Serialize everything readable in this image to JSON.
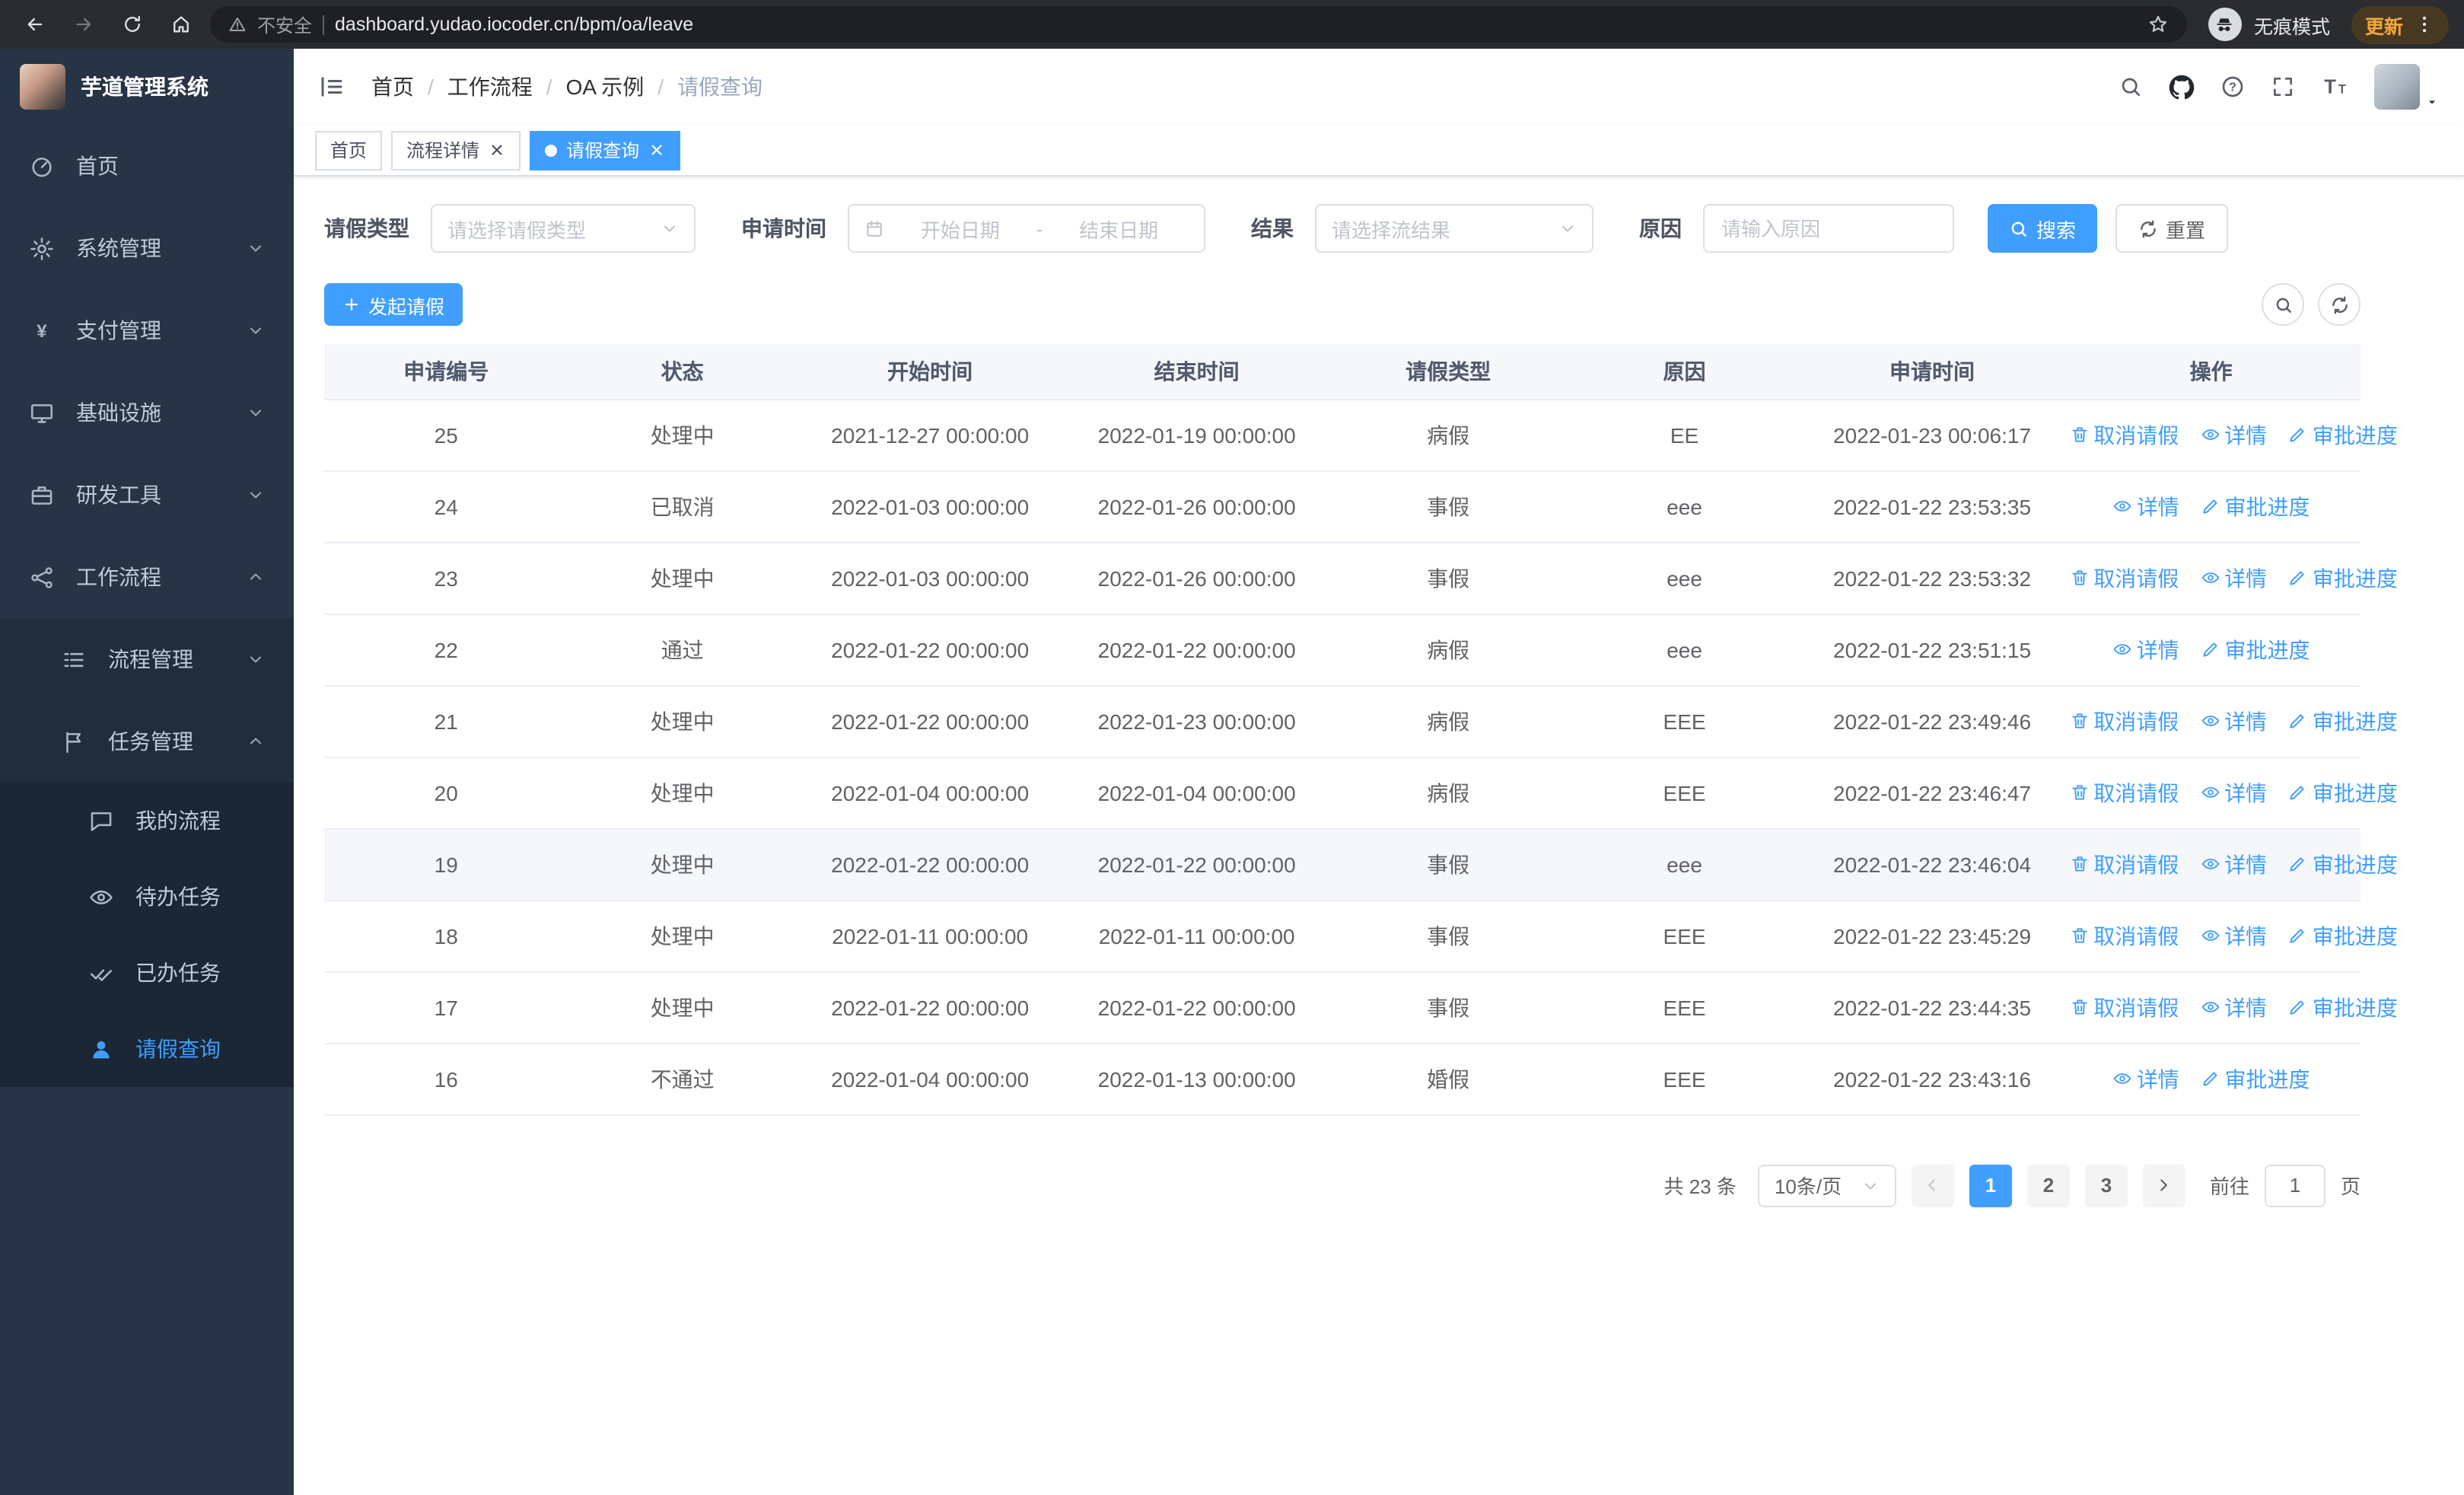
{
  "browser": {
    "security_label": "不安全",
    "url": "dashboard.yudao.iocoder.cn/bpm/oa/leave",
    "incognito_label": "无痕模式",
    "update_label": "更新"
  },
  "sidebar": {
    "logo_title": "芋道管理系统",
    "items": [
      {
        "label": "首页"
      },
      {
        "label": "系统管理"
      },
      {
        "label": "支付管理"
      },
      {
        "label": "基础设施"
      },
      {
        "label": "研发工具"
      },
      {
        "label": "工作流程"
      }
    ],
    "workflow_children": [
      {
        "label": "流程管理"
      },
      {
        "label": "任务管理"
      }
    ],
    "task_children": [
      {
        "label": "我的流程"
      },
      {
        "label": "待办任务"
      },
      {
        "label": "已办任务"
      },
      {
        "label": "请假查询"
      }
    ]
  },
  "breadcrumb": {
    "separator": "/",
    "items": [
      "首页",
      "工作流程",
      "OA 示例",
      "请假查询"
    ]
  },
  "tabs": [
    {
      "label": "首页"
    },
    {
      "label": "流程详情"
    },
    {
      "label": "请假查询"
    }
  ],
  "filters": {
    "leave_type_label": "请假类型",
    "leave_type_placeholder": "请选择请假类型",
    "apply_time_label": "申请时间",
    "start_date_placeholder": "开始日期",
    "range_separator": "-",
    "end_date_placeholder": "结束日期",
    "result_label": "结果",
    "result_placeholder": "请选择流结果",
    "reason_label": "原因",
    "reason_placeholder": "请输入原因",
    "search_label": "搜索",
    "reset_label": "重置"
  },
  "toolbar": {
    "create_label": "发起请假"
  },
  "table": {
    "columns": [
      "申请编号",
      "状态",
      "开始时间",
      "结束时间",
      "请假类型",
      "原因",
      "申请时间",
      "操作"
    ],
    "action_labels": {
      "cancel": "取消请假",
      "detail": "详情",
      "progress": "审批进度"
    },
    "rows": [
      {
        "id": "25",
        "status": "处理中",
        "start_time": "2021-12-27 00:00:00",
        "end_time": "2022-01-19 00:00:00",
        "leave_type": "病假",
        "reason": "EE",
        "apply_time": "2022-01-23 00:06:17",
        "cancellable": true,
        "highlighted": false
      },
      {
        "id": "24",
        "status": "已取消",
        "start_time": "2022-01-03 00:00:00",
        "end_time": "2022-01-26 00:00:00",
        "leave_type": "事假",
        "reason": "eee",
        "apply_time": "2022-01-22 23:53:35",
        "cancellable": false,
        "highlighted": false
      },
      {
        "id": "23",
        "status": "处理中",
        "start_time": "2022-01-03 00:00:00",
        "end_time": "2022-01-26 00:00:00",
        "leave_type": "事假",
        "reason": "eee",
        "apply_time": "2022-01-22 23:53:32",
        "cancellable": true,
        "highlighted": false
      },
      {
        "id": "22",
        "status": "通过",
        "start_time": "2022-01-22 00:00:00",
        "end_time": "2022-01-22 00:00:00",
        "leave_type": "病假",
        "reason": "eee",
        "apply_time": "2022-01-22 23:51:15",
        "cancellable": false,
        "highlighted": false
      },
      {
        "id": "21",
        "status": "处理中",
        "start_time": "2022-01-22 00:00:00",
        "end_time": "2022-01-23 00:00:00",
        "leave_type": "病假",
        "reason": "EEE",
        "apply_time": "2022-01-22 23:49:46",
        "cancellable": true,
        "highlighted": false
      },
      {
        "id": "20",
        "status": "处理中",
        "start_time": "2022-01-04 00:00:00",
        "end_time": "2022-01-04 00:00:00",
        "leave_type": "病假",
        "reason": "EEE",
        "apply_time": "2022-01-22 23:46:47",
        "cancellable": true,
        "highlighted": false
      },
      {
        "id": "19",
        "status": "处理中",
        "start_time": "2022-01-22 00:00:00",
        "end_time": "2022-01-22 00:00:00",
        "leave_type": "事假",
        "reason": "eee",
        "apply_time": "2022-01-22 23:46:04",
        "cancellable": true,
        "highlighted": true
      },
      {
        "id": "18",
        "status": "处理中",
        "start_time": "2022-01-11 00:00:00",
        "end_time": "2022-01-11 00:00:00",
        "leave_type": "事假",
        "reason": "EEE",
        "apply_time": "2022-01-22 23:45:29",
        "cancellable": true,
        "highlighted": false
      },
      {
        "id": "17",
        "status": "处理中",
        "start_time": "2022-01-22 00:00:00",
        "end_time": "2022-01-22 00:00:00",
        "leave_type": "事假",
        "reason": "EEE",
        "apply_time": "2022-01-22 23:44:35",
        "cancellable": true,
        "highlighted": false
      },
      {
        "id": "16",
        "status": "不通过",
        "start_time": "2022-01-04 00:00:00",
        "end_time": "2022-01-13 00:00:00",
        "leave_type": "婚假",
        "reason": "EEE",
        "apply_time": "2022-01-22 23:43:16",
        "cancellable": false,
        "highlighted": false
      }
    ]
  },
  "pagination": {
    "total_label": "共 23 条",
    "page_size_label": "10条/页",
    "pages": [
      "1",
      "2",
      "3"
    ],
    "active_index": 0,
    "goto_label": "前往",
    "goto_value": "1",
    "unit_label": "页"
  },
  "colors": {
    "primary": "#409eff",
    "sidebar_bg": "#263445",
    "sidebar_submenu_bg": "#1f2d3d",
    "table_header_bg": "#f5f7fa"
  }
}
